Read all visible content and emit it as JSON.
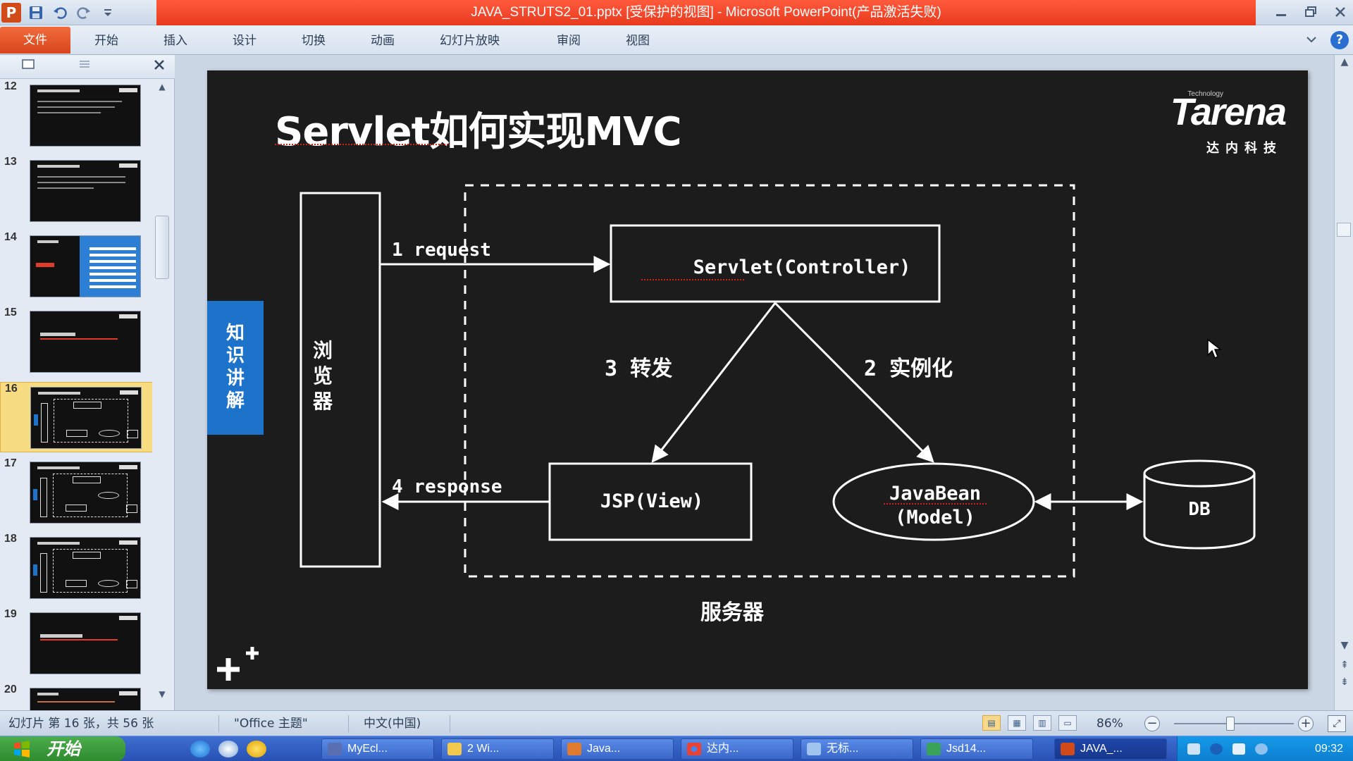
{
  "window": {
    "title": "JAVA_STRUTS2_01.pptx [受保护的视图] - Microsoft PowerPoint(产品激活失败)"
  },
  "ribbon": {
    "tabs": [
      "文件",
      "开始",
      "插入",
      "设计",
      "切换",
      "动画",
      "幻灯片放映",
      "审阅",
      "视图"
    ]
  },
  "thumbnails": {
    "numbers": [
      "12",
      "13",
      "14",
      "15",
      "16",
      "17",
      "18",
      "19",
      "20"
    ],
    "active": "16"
  },
  "slide": {
    "title": "Servlet如何实现MVC",
    "logo": {
      "main": "Tarena",
      "top": "Technology",
      "sub": "达内科技"
    },
    "side_tag": [
      "知",
      "识",
      "讲",
      "解"
    ],
    "diagram": {
      "browser": [
        "浏",
        "览",
        "器"
      ],
      "servlet": "Servlet(Controller)",
      "jsp": "JSP(View)",
      "javabean_line1": "JavaBean",
      "javabean_line2": "(Model)",
      "db": "DB",
      "request": "1 request",
      "response": "4 response",
      "forward": "3 转发",
      "instantiate": "2 实例化",
      "server": "服务器"
    }
  },
  "status": {
    "slide_info": "幻灯片 第 16 张，共 56 张",
    "theme": "\"Office 主题\"",
    "language": "中文(中国)",
    "zoom": "86%",
    "zoom_value": 0.47
  },
  "taskbar": {
    "start": "开始",
    "tasks": [
      "MyEcl...",
      "2 Wi...",
      "Java...",
      "达内...",
      "无标...",
      "Jsd14...",
      "JAVA_..."
    ],
    "clock": "09:32"
  },
  "colors": {
    "title_bar": "#e8391d",
    "file_tab": "#d7461c",
    "side_tag": "#1d73c9",
    "slide_bg": "#1c1c1c"
  }
}
